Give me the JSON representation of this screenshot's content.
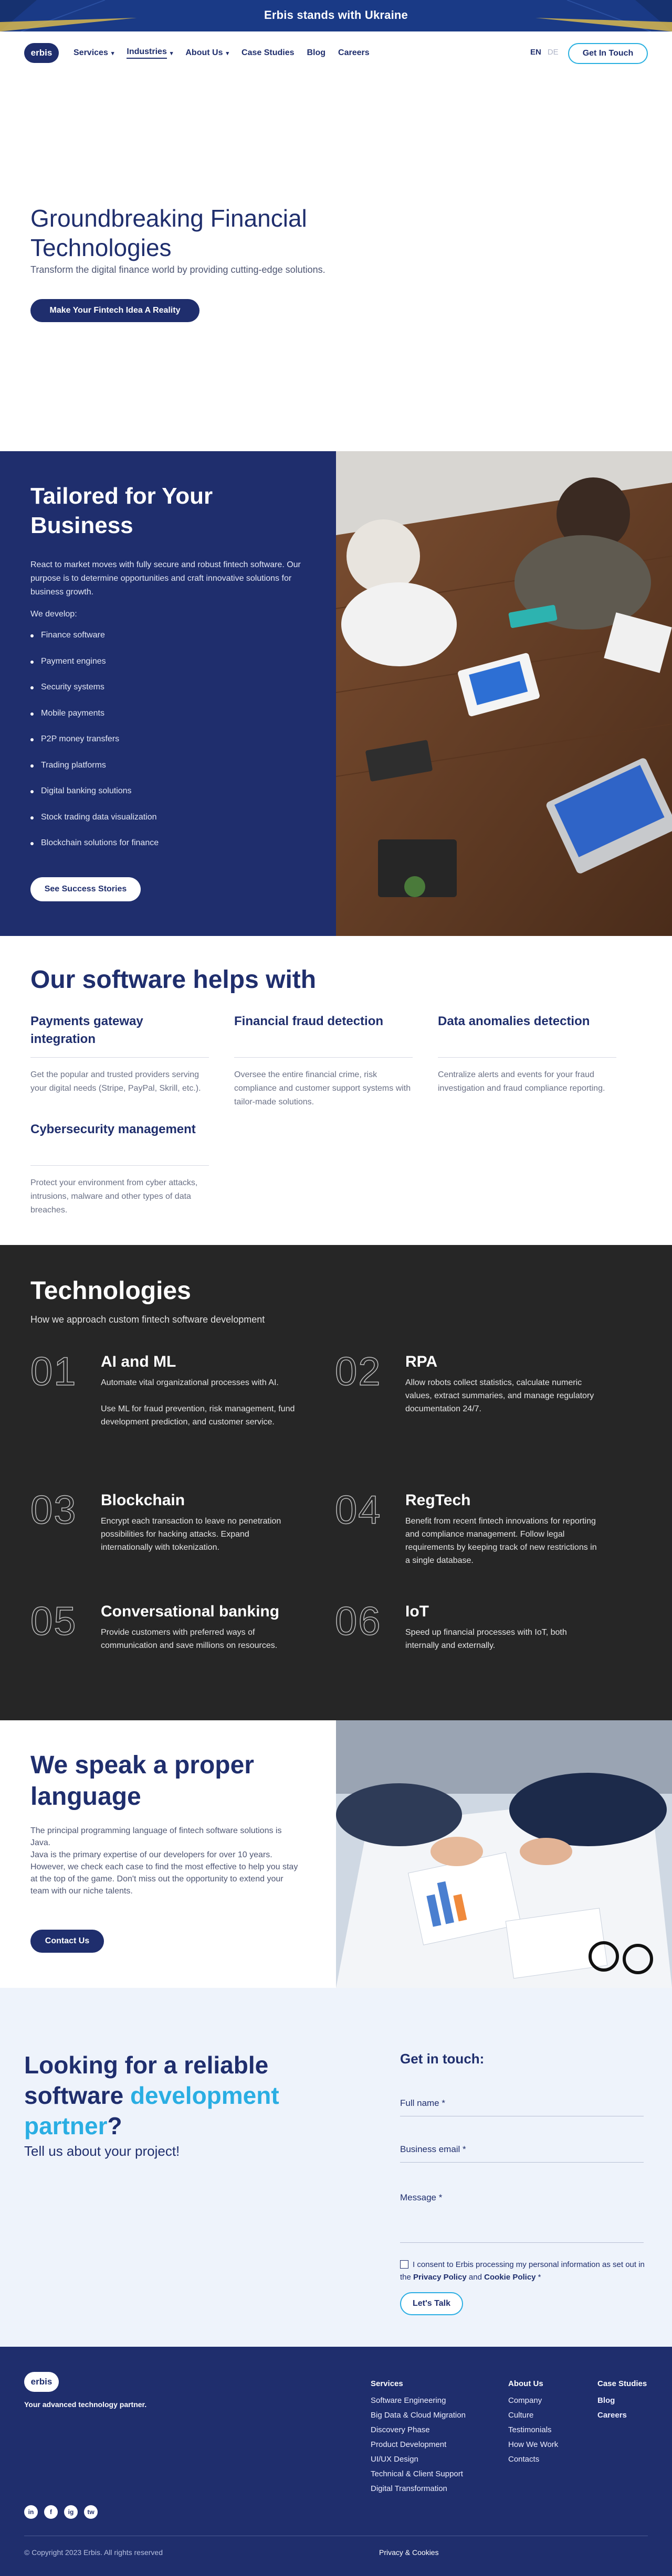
{
  "banner": {
    "text": "Erbis stands with Ukraine"
  },
  "header": {
    "logo": "erbis",
    "nav": [
      {
        "label": "Services",
        "has_dropdown": true
      },
      {
        "label": "Industries",
        "has_dropdown": true,
        "active": true
      },
      {
        "label": "About Us",
        "has_dropdown": true
      },
      {
        "label": "Case Studies"
      },
      {
        "label": "Blog"
      },
      {
        "label": "Careers"
      }
    ],
    "lang_active": "EN",
    "lang_other": "DE",
    "cta": "Get In Touch"
  },
  "hero": {
    "title": "Groundbreaking Financial Technologies",
    "subtitle": "Transform the digital finance world by providing cutting-edge solutions.",
    "button": "Make Your Fintech Idea A Reality"
  },
  "tailored": {
    "title": "Tailored for Your Business",
    "description": "React to market moves with fully secure and robust fintech software. Our purpose is to determine opportunities and craft innovative solutions for business growth.",
    "we_develop": "We develop:",
    "items": [
      "Finance software",
      "Payment engines",
      "Security systems",
      "Mobile payments",
      "P2P money transfers",
      "Trading platforms",
      "Digital banking solutions",
      "Stock trading data visualization",
      "Blockchain solutions for finance"
    ],
    "button": "See Success Stories"
  },
  "helps": {
    "title": "Our software helps with",
    "cards": [
      {
        "title": "Payments gateway integration",
        "text": "Get the popular and trusted providers serving your digital needs (Stripe, PayPal, Skrill, etc.)."
      },
      {
        "title": "Financial fraud detection",
        "text": "Oversee the entire financial crime, risk compliance and customer support systems with tailor-made solutions."
      },
      {
        "title": "Data anomalies detection",
        "text": "Centralize alerts and events for your fraud investigation and fraud compliance reporting."
      },
      {
        "title": "Cybersecurity management",
        "text": "Protect your environment from cyber attacks, intrusions, malware and other types of data breaches."
      }
    ]
  },
  "technologies": {
    "title": "Technologies",
    "subtitle": "How we approach custom fintech software development",
    "items": [
      {
        "num": "01",
        "title": "AI and ML",
        "text": "Automate vital organizational processes with AI.\n\nUse ML for fraud prevention, risk management, fund development prediction, and customer service."
      },
      {
        "num": "02",
        "title": "RPA",
        "text": "Allow robots collect statistics, calculate numeric values, extract summaries, and manage regulatory documentation 24/7."
      },
      {
        "num": "03",
        "title": "Blockchain",
        "text": "Encrypt each transaction to leave no penetration possibilities for hacking attacks. Expand internationally with tokenization."
      },
      {
        "num": "04",
        "title": "RegTech",
        "text": "Benefit from recent fintech innovations for reporting and compliance management. Follow legal requirements by keeping track of new restrictions in a single database."
      },
      {
        "num": "05",
        "title": "Conversational banking",
        "text": "Provide customers with preferred ways of communication and save millions on resources."
      },
      {
        "num": "06",
        "title": "IoT",
        "text": "Speed up financial processes with IoT, both internally and externally."
      }
    ]
  },
  "language": {
    "title": "We speak a proper language",
    "text": "The principal programming language of fintech software solutions is Java.\nJava is the primary expertise of our developers for over 10 years. However, we check each case to find the most effective to help you stay at the top of the game. Don't miss out the opportunity to extend your team with our niche talents.",
    "button": "Contact Us"
  },
  "contact": {
    "title_part1": "Looking for a reliable software ",
    "title_highlight": "development partner",
    "title_part2": "?",
    "tell": "Tell us about your project!",
    "form_title": "Get in touch:",
    "full_name": "Full name *",
    "email": "Business email *",
    "message": "Message *",
    "consent_text": "I consent to Erbis processing my personal information as set out in the ",
    "privacy_policy": "Privacy Policy",
    "and": " and ",
    "cookie_policy": "Cookie Policy",
    "asterisk": " *",
    "button": "Let's Talk"
  },
  "footer": {
    "logo": "erbis",
    "tagline": "Your advanced technology partner.",
    "services_title": "Services",
    "services": [
      "Software Engineering",
      "Big Data & Cloud Migration",
      "Discovery Phase",
      "Product Development",
      "UI/UX Design",
      "Technical & Client Support",
      "Digital Transformation"
    ],
    "about_title": "About Us",
    "about": [
      "Company",
      "Culture",
      "Testimonials",
      "How We Work",
      "Contacts"
    ],
    "links": [
      "Case Studies",
      "Blog",
      "Careers"
    ],
    "social": [
      "in",
      "f",
      "ig",
      "tw"
    ],
    "copyright": "© Copyright 2023 Erbis. All rights reserved",
    "privacy": "Privacy & Cookies"
  },
  "colors": {
    "navy": "#1f2e6d",
    "accent": "#2aaee3",
    "dark": "#262626"
  }
}
